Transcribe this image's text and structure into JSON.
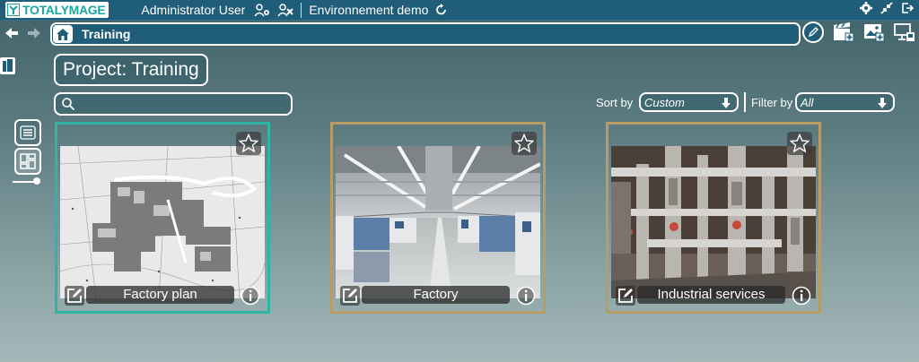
{
  "app": {
    "logo_text": "TOTALYMAGE",
    "user": "Administrator User",
    "environment": "Environnement demo"
  },
  "breadcrumb": {
    "current": "Training"
  },
  "project": {
    "title": "Project: Training"
  },
  "search": {
    "value": "",
    "placeholder": ""
  },
  "sort": {
    "label": "Sort by",
    "value": "Custom"
  },
  "filter": {
    "label": "Filter by",
    "value": "All"
  },
  "cards": [
    {
      "title": "Factory plan",
      "kind": "plan",
      "selected": true
    },
    {
      "title": "Factory",
      "kind": "factory",
      "selected": false
    },
    {
      "title": "Industrial services",
      "kind": "pipes",
      "selected": false
    }
  ],
  "colors": {
    "topbar": "#1f5d78",
    "accent": "#2fb5a6",
    "card_border": "#b89c68"
  },
  "icons": [
    "user-settings-icon",
    "user-delete-icon",
    "refresh-icon",
    "settings-icon",
    "minimize-icon",
    "logout-icon",
    "back-arrow-icon",
    "forward-arrow-icon",
    "home-icon",
    "edit-circle-icon",
    "add-scene-icon",
    "add-image-icon",
    "presentation-icon",
    "list-view-icon",
    "grid-view-icon",
    "star-icon",
    "edit-icon",
    "info-icon",
    "search-icon"
  ]
}
